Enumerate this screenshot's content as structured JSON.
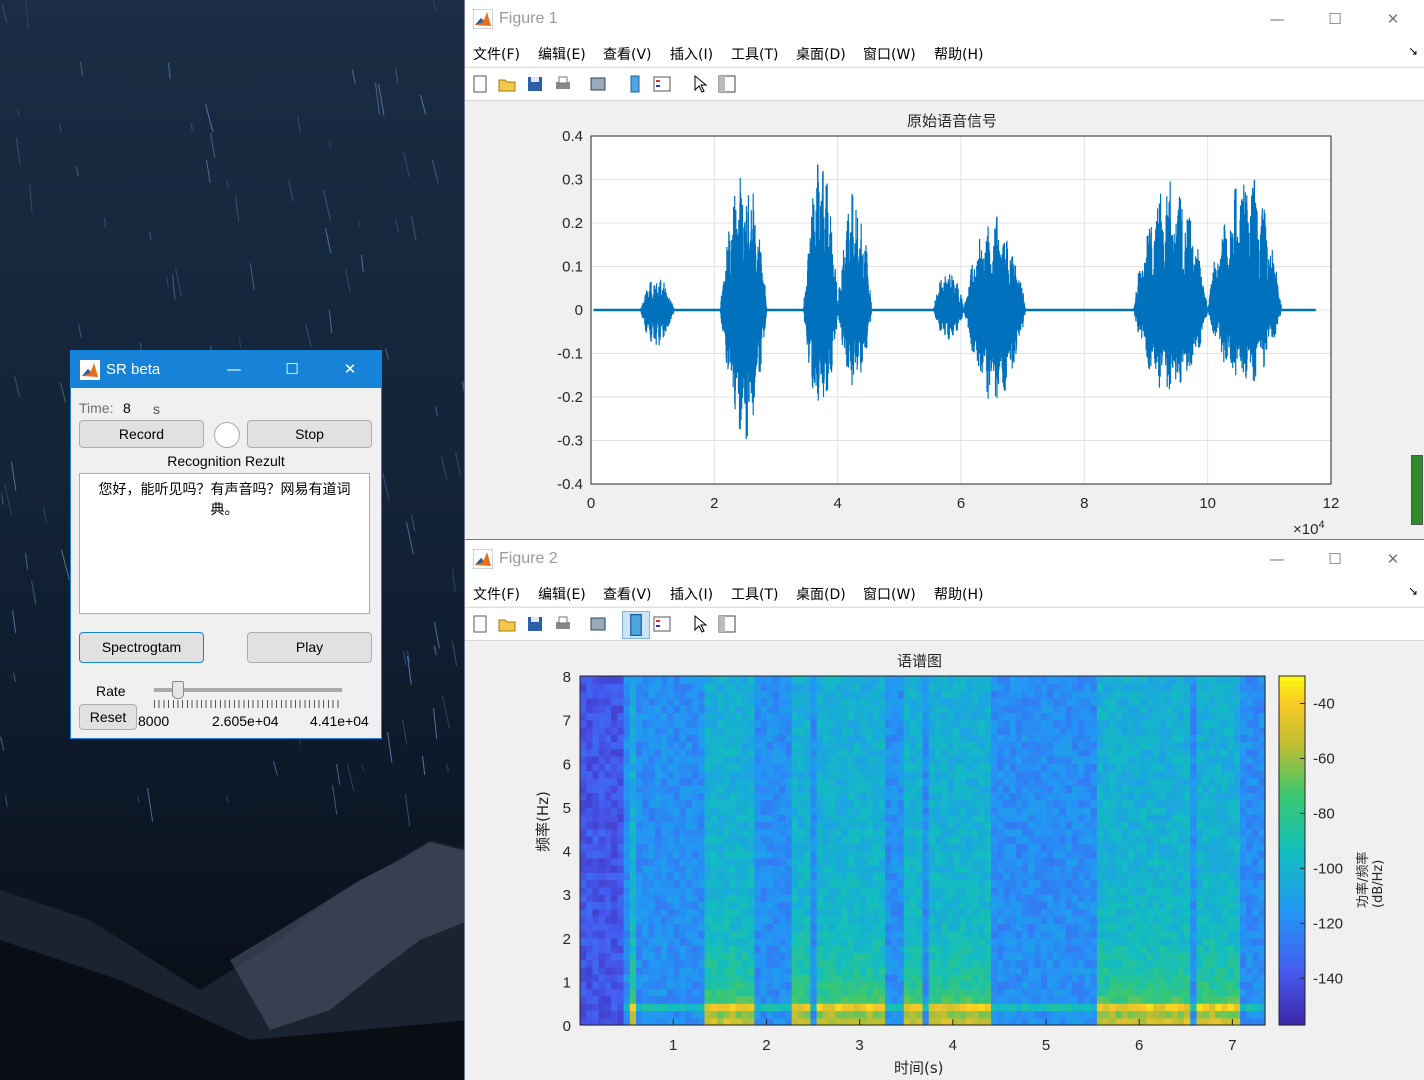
{
  "figure1": {
    "title": "Figure 1",
    "menu": [
      "文件(F)",
      "编辑(E)",
      "查看(V)",
      "插入(I)",
      "工具(T)",
      "桌面(D)",
      "窗口(W)",
      "帮助(H)"
    ],
    "window_controls": {
      "minimize": "—",
      "maximize": "☐",
      "close": "✕"
    }
  },
  "figure2": {
    "title": "Figure 2",
    "menu": [
      "文件(F)",
      "编辑(E)",
      "查看(V)",
      "插入(I)",
      "工具(T)",
      "桌面(D)",
      "窗口(W)",
      "帮助(H)"
    ],
    "window_controls": {
      "minimize": "—",
      "maximize": "☐",
      "close": "✕"
    }
  },
  "sr": {
    "title": "SR beta",
    "time_label": "Time:",
    "time_value": "8",
    "time_unit": "s",
    "record_label": "Record",
    "stop_label": "Stop",
    "result_label": "Recognition Rezult",
    "result_text": "您好，能听见吗？有声音吗？网易有道词典。",
    "spectrogram_label": "Spectrogtam",
    "play_label": "Play",
    "rate_label": "Rate",
    "reset_label": "Reset",
    "rate_min": "8000",
    "rate_mid": "2.605e+04",
    "rate_max": "4.41e+04",
    "rate_fraction": 0.12
  },
  "chart_data": [
    {
      "type": "line",
      "title": "原始语音信号",
      "xlabel": "",
      "ylabel": "",
      "xlim": [
        0,
        12
      ],
      "ylim": [
        -0.4,
        0.4
      ],
      "x_exponent_label": "×10",
      "x_exponent": "4",
      "xticks": [
        "0",
        "2",
        "4",
        "6",
        "8",
        "10",
        "12"
      ],
      "yticks": [
        "0.4",
        "0.3",
        "0.2",
        "0.1",
        "0",
        "-0.1",
        "-0.2",
        "-0.3",
        "-0.4"
      ],
      "grid": true,
      "color": "#0072bd",
      "bursts": [
        {
          "x0": 0.8,
          "x1": 1.35,
          "amp_pos": 0.08,
          "amp_neg": 0.09
        },
        {
          "x0": 2.1,
          "x1": 2.85,
          "amp_pos": 0.33,
          "amp_neg": 0.31
        },
        {
          "x0": 3.45,
          "x1": 4.0,
          "amp_pos": 0.37,
          "amp_neg": 0.25
        },
        {
          "x0": 4.0,
          "x1": 4.55,
          "amp_pos": 0.28,
          "amp_neg": 0.18
        },
        {
          "x0": 5.55,
          "x1": 6.05,
          "amp_pos": 0.1,
          "amp_neg": 0.07
        },
        {
          "x0": 6.05,
          "x1": 7.05,
          "amp_pos": 0.22,
          "amp_neg": 0.22
        },
        {
          "x0": 8.8,
          "x1": 10.0,
          "amp_pos": 0.31,
          "amp_neg": 0.21
        },
        {
          "x0": 10.0,
          "x1": 11.2,
          "amp_pos": 0.33,
          "amp_neg": 0.18
        }
      ]
    },
    {
      "type": "heatmap",
      "title": "语谱图",
      "xlabel": "时间(s)",
      "ylabel": "频率(Hz)",
      "xlim": [
        0,
        7.35
      ],
      "ylim": [
        0,
        8
      ],
      "xticks": [
        "1",
        "2",
        "3",
        "4",
        "5",
        "6",
        "7"
      ],
      "yticks": [
        "8",
        "7",
        "6",
        "5",
        "4",
        "3",
        "2",
        "1",
        "0"
      ],
      "colorbar_label": "功率/频率(dB/Hz)",
      "colorbar_ticks": [
        "-40",
        "-60",
        "-80",
        "-100",
        "-120",
        "-140"
      ],
      "colorbar_range": [
        -157,
        -30
      ],
      "colormap": "parula"
    }
  ]
}
